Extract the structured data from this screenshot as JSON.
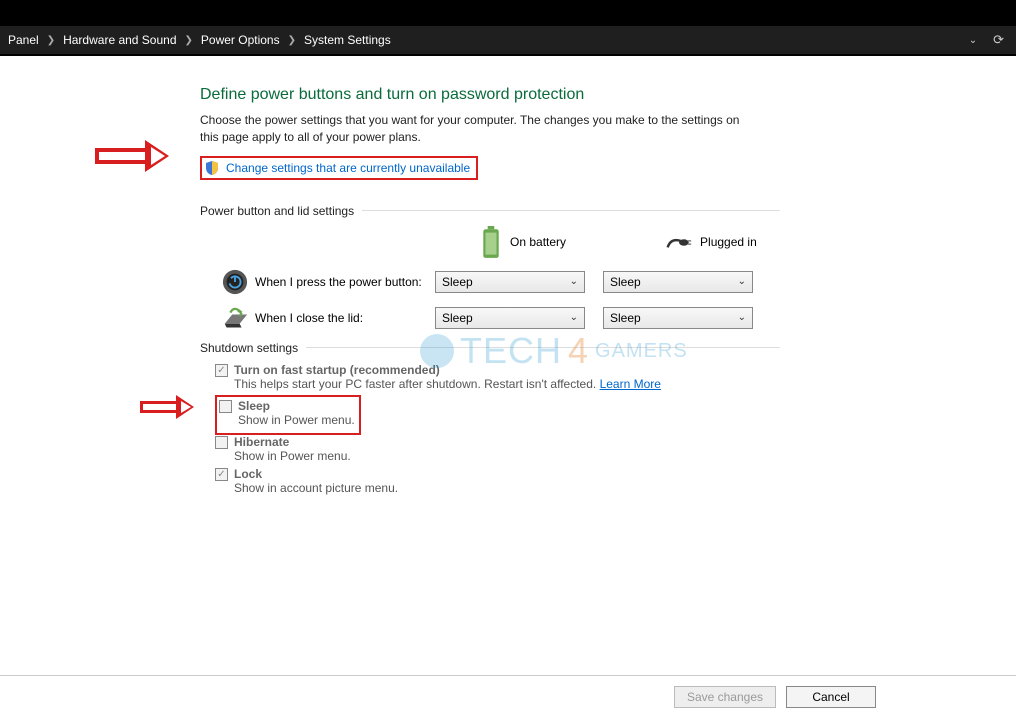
{
  "breadcrumb": {
    "items": [
      "Panel",
      "Hardware and Sound",
      "Power Options",
      "System Settings"
    ]
  },
  "heading": "Define power buttons and turn on password protection",
  "description": "Choose the power settings that you want for your computer. The changes you make to the settings on this page apply to all of your power plans.",
  "change_link": "Change settings that are currently unavailable",
  "sections": {
    "power_button": "Power button and lid settings",
    "shutdown": "Shutdown settings"
  },
  "columns": {
    "battery": "On battery",
    "plugged": "Plugged in"
  },
  "rows": {
    "press_button": {
      "label": "When I press the power button:",
      "battery": "Sleep",
      "plugged": "Sleep"
    },
    "close_lid": {
      "label": "When I close the lid:",
      "battery": "Sleep",
      "plugged": "Sleep"
    }
  },
  "shutdown_items": {
    "fast": {
      "title": "Turn on fast startup (recommended)",
      "desc": "This helps start your PC faster after shutdown. Restart isn't affected.",
      "learn": "Learn More"
    },
    "sleep": {
      "title": "Sleep",
      "desc": "Show in Power menu."
    },
    "hibernate": {
      "title": "Hibernate",
      "desc": "Show in Power menu."
    },
    "lock": {
      "title": "Lock",
      "desc": "Show in account picture menu."
    }
  },
  "buttons": {
    "save": "Save changes",
    "cancel": "Cancel"
  },
  "watermark": {
    "a": "TECH",
    "b": "4",
    "c": "GAMERS"
  }
}
